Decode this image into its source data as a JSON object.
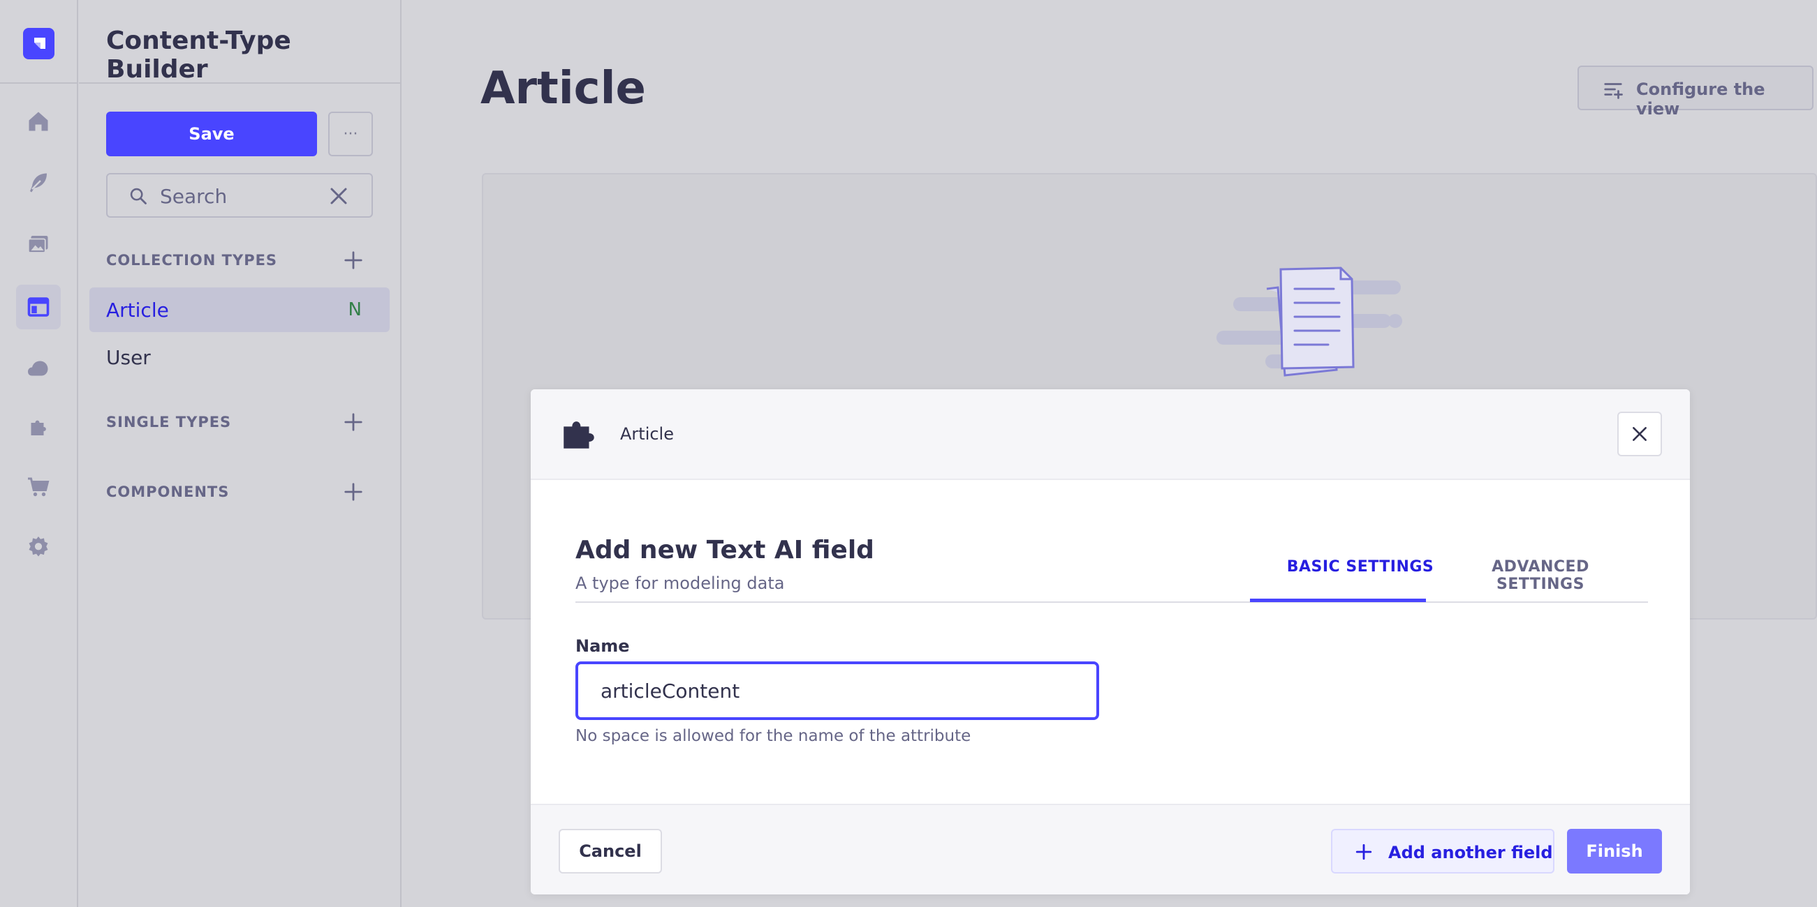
{
  "app": {
    "builder_title": "Content-Type Builder",
    "accent_color": "#4945ff"
  },
  "rail": {
    "icons": [
      "home-icon",
      "feather-icon",
      "media-icon",
      "layout-icon",
      "cloud-icon",
      "puzzle-icon",
      "cart-icon",
      "gear-icon"
    ],
    "active": "layout-icon"
  },
  "sidebar": {
    "save_label": "Save",
    "more_label": "···",
    "search_placeholder": "Search",
    "sections": {
      "collection_types": "COLLECTION TYPES",
      "single_types": "SINGLE TYPES",
      "components": "COMPONENTS"
    },
    "collection_items": [
      {
        "label": "Article",
        "badge": "N"
      },
      {
        "label": "User"
      }
    ]
  },
  "main": {
    "title": "Article",
    "configure_label": "Configure the view"
  },
  "modal": {
    "breadcrumb": "Article",
    "heading": "Add new Text AI field",
    "subheading": "A type for modeling data",
    "tabs": [
      {
        "label": "BASIC SETTINGS",
        "active": true
      },
      {
        "label": "ADVANCED SETTINGS",
        "active": false
      }
    ],
    "name_label": "Name",
    "name_value": "articleContent",
    "name_hint": "No space is allowed for the name of the attribute",
    "cancel_label": "Cancel",
    "add_another_label": "Add another field",
    "finish_label": "Finish"
  }
}
